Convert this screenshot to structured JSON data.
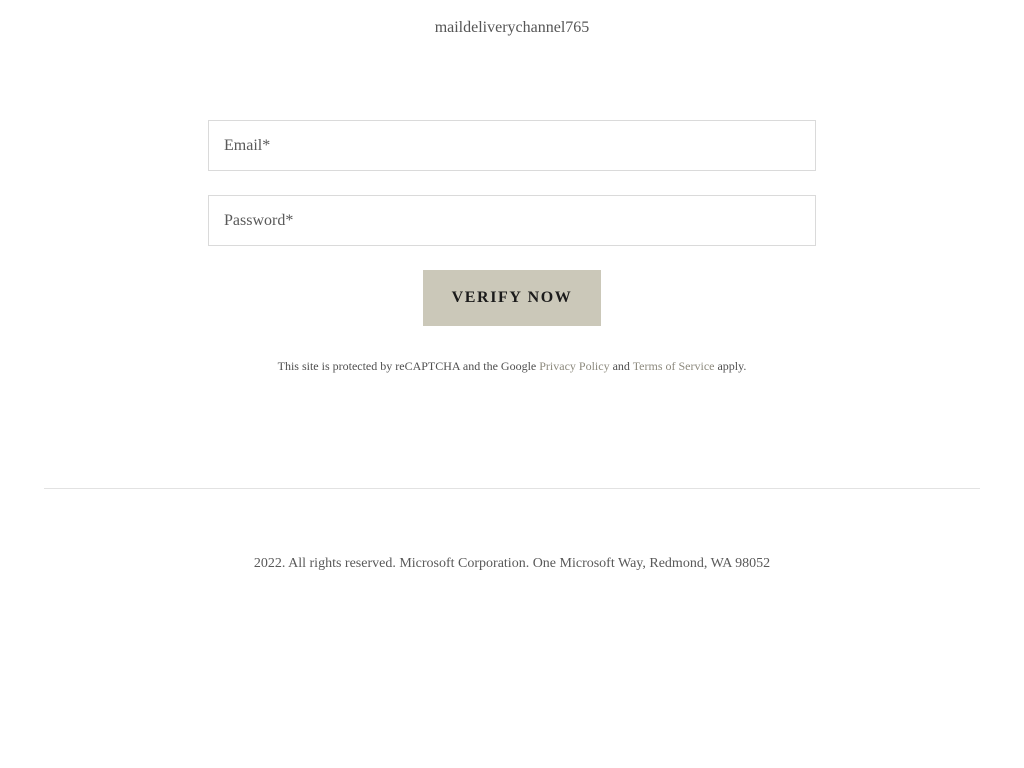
{
  "header": {
    "logo_alt": "maildeliverychannel765"
  },
  "form": {
    "email_placeholder": "Email*",
    "email_value": "",
    "password_placeholder": "Password*",
    "password_value": "",
    "verify_label": "VERIFY NOW"
  },
  "recaptcha": {
    "prefix": "This site is protected by reCAPTCHA and the Google ",
    "privacy_link": "Privacy Policy",
    "and": " and ",
    "terms_link": "Terms of Service",
    "suffix": " apply."
  },
  "footer": {
    "text": "2022. All rights reserved. Microsoft Corporation. One Microsoft Way, Redmond, WA 98052"
  },
  "colors": {
    "button_bg": "#cbc8b9",
    "link": "#8d8a7e",
    "border": "#dadada"
  }
}
